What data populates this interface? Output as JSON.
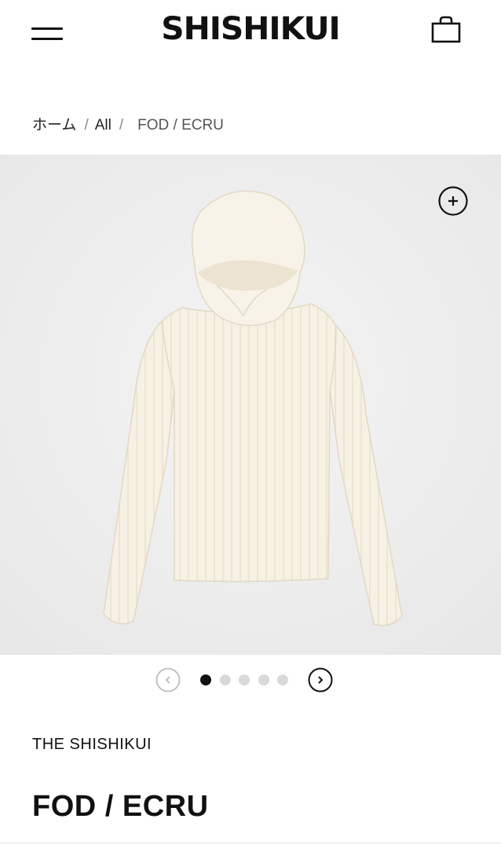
{
  "header": {
    "logo": "SHISHIKUI",
    "menu_icon": "hamburger-menu-icon",
    "cart_icon": "shopping-bag-icon"
  },
  "breadcrumb": {
    "items": [
      "ホーム",
      "All"
    ],
    "separator": "/",
    "current": "FOD / ECRU"
  },
  "gallery": {
    "zoom_icon": "plus-circle-icon",
    "image_subject": "hooded-ribbed-top-ecru",
    "slide_count": 5,
    "active_slide": 1,
    "prev_icon": "chevron-left-icon",
    "next_icon": "chevron-right-icon"
  },
  "product": {
    "brand": "THE SHISHIKUI",
    "title": "FOD / ECRU"
  },
  "colors": {
    "text": "#111111",
    "gallery_bg": "#ececec",
    "garment": "#f6f0e2",
    "dot_inactive": "#d9d9d9"
  }
}
